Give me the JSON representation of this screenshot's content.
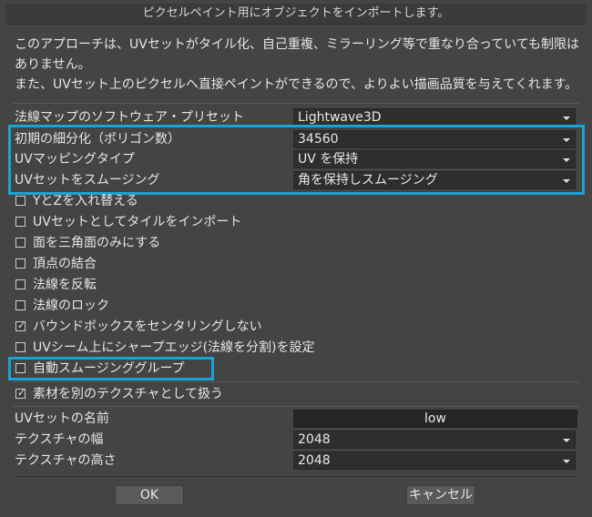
{
  "window": {
    "title": "ピクセルペイント用にオブジェクトをインポートします。"
  },
  "description": {
    "line1": "このアプローチは、UVセットがタイル化、自己重複、ミラーリング等で重なり合っていても制限は",
    "line2": "ありません。",
    "line3": "また、UVセット上のピクセルへ直接ペイントができるので、よりよい描画品質を与えてくれます。"
  },
  "fields": {
    "normal_map_preset": {
      "label": "法線マップのソフトウェア・プリセット",
      "value": "Lightwave3D"
    },
    "initial_subdivision": {
      "label": "初期の細分化（ポリゴン数）",
      "value": "34560"
    },
    "uv_mapping_type": {
      "label": "UVマッピングタイプ",
      "value": "UV を保持"
    },
    "uv_smoothing": {
      "label": "UVセットをスムージング",
      "value": "角を保持しスムージング"
    }
  },
  "checkboxes": [
    {
      "label": "YとZを入れ替える",
      "checked": false
    },
    {
      "label": "UVセットとしてタイルをインポート",
      "checked": false
    },
    {
      "label": "面を三角面のみにする",
      "checked": false
    },
    {
      "label": "頂点の結合",
      "checked": false
    },
    {
      "label": "法線を反転",
      "checked": false
    },
    {
      "label": "法線のロック",
      "checked": false
    },
    {
      "label": "バウンドボックスをセンタリングしない",
      "checked": true
    },
    {
      "label": "UVシーム上にシャープエッジ(法線を分割)を設定",
      "checked": false
    },
    {
      "label": "自動スムージンググループ",
      "checked": false
    }
  ],
  "material_checkbox": {
    "label": "素材を別のテクスチャとして扱う",
    "checked": true
  },
  "uv_set_name": {
    "label": "UVセットの名前",
    "value": "low"
  },
  "texture_width": {
    "label": "テクスチャの幅",
    "value": "2048"
  },
  "texture_height": {
    "label": "テクスチャの高さ",
    "value": "2048"
  },
  "buttons": {
    "ok": "OK",
    "cancel": "キャンセル"
  },
  "colors": {
    "highlight": "#1aa3d6",
    "background": "#444444",
    "field": "#2e2e2e"
  }
}
